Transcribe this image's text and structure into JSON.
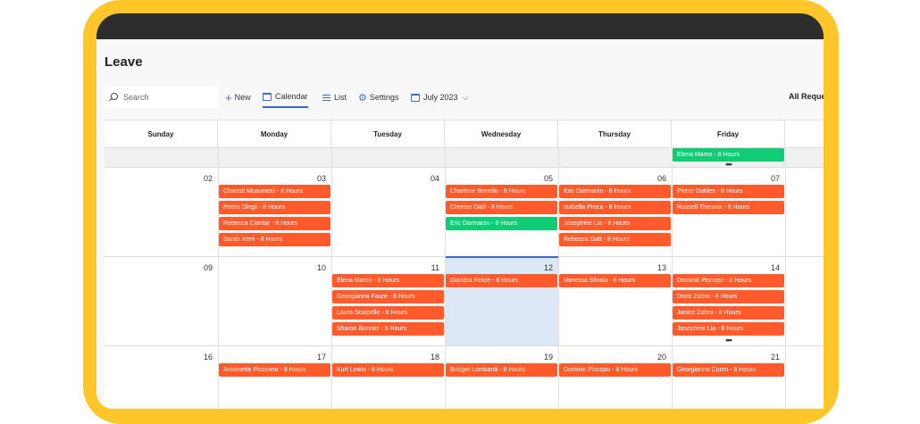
{
  "app": {
    "title": "Leave"
  },
  "toolbar": {
    "search_placeholder": "Search",
    "new_label": "New",
    "calendar_label": "Calendar",
    "list_label": "List",
    "settings_label": "Settings",
    "month_label": "July 2023",
    "filter_label": "All Reques"
  },
  "calendar": {
    "days": [
      "Sunday",
      "Monday",
      "Tuesday",
      "Wednesday",
      "Thursday",
      "Friday"
    ],
    "more_label": "•••",
    "prev_week": {
      "friday_events": [
        {
          "label": "Elena Mamo - 8 Hours",
          "color": "green"
        }
      ],
      "friday_more": true
    },
    "weeks": [
      {
        "dates": [
          "02",
          "03",
          "04",
          "05",
          "06",
          "07"
        ],
        "events": [
          [],
          [
            {
              "label": "Chantal Musumeci - 8 Hours",
              "color": "orange"
            },
            {
              "label": "Pedro Dingli - 8 Hours",
              "color": "orange"
            },
            {
              "label": "Rebecca Ciantar - 8 Hours",
              "color": "orange"
            },
            {
              "label": "Sarah Xerri - 8 Hours",
              "color": "orange"
            }
          ],
          [],
          [
            {
              "label": "Charlene Bonello - 8 Hours",
              "color": "orange"
            },
            {
              "label": "Cherise Dalli - 8 Hours",
              "color": "orange"
            },
            {
              "label": "Eric Darmanin - 8 Hours",
              "color": "green"
            }
          ],
          [
            {
              "label": "Eric Darmanin - 8 Hours",
              "color": "orange"
            },
            {
              "label": "Isabella Preca - 8 Hours",
              "color": "orange"
            },
            {
              "label": "Josephine Lia - 8 Hours",
              "color": "orange"
            },
            {
              "label": "Rebecca Gatt - 8 Hours",
              "color": "orange"
            }
          ],
          [
            {
              "label": "Pierre Galdes - 8 Hours",
              "color": "orange"
            },
            {
              "label": "Russell Theuma - 8 Hours",
              "color": "orange"
            }
          ]
        ]
      },
      {
        "dates": [
          "09",
          "10",
          "11",
          "12",
          "13",
          "14"
        ],
        "today_index": 3,
        "friday_more": true,
        "events": [
          [],
          [],
          [
            {
              "label": "Elena Mamo - 8 Hours",
              "color": "orange"
            },
            {
              "label": "Georgianna Faure - 8 Hours",
              "color": "orange"
            },
            {
              "label": "Laura Scalpello - 8 Hours",
              "color": "orange"
            },
            {
              "label": "Sharon Bonnici - 8 Hours",
              "color": "orange"
            }
          ],
          [
            {
              "label": "Diandra Felice - 8 Hours",
              "color": "orange"
            }
          ],
          [
            {
              "label": "Vanessa Silvala - 8 Hours",
              "color": "orange"
            }
          ],
          [
            {
              "label": "Dominic Piscopo - 8 Hours",
              "color": "orange"
            },
            {
              "label": "Doris Zahra - 8 Hours",
              "color": "orange"
            },
            {
              "label": "Janice Zahra - 8 Hours",
              "color": "orange"
            },
            {
              "label": "Josephine Lia - 8 Hours",
              "color": "orange"
            }
          ]
        ]
      },
      {
        "dates": [
          "16",
          "17",
          "18",
          "19",
          "20",
          "21"
        ],
        "events": [
          [],
          [
            {
              "label": "Antoinette Piccinino - 8 Hours",
              "color": "orange"
            }
          ],
          [
            {
              "label": "Kurt Lewis - 8 Hours",
              "color": "orange"
            }
          ],
          [
            {
              "label": "Bridget Lombardi - 8 Hours",
              "color": "orange"
            }
          ],
          [
            {
              "label": "Dominic Piscopo - 8 Hours",
              "color": "orange"
            }
          ],
          [
            {
              "label": "Georgianna Curmi - 8 Hours",
              "color": "orange"
            }
          ]
        ]
      }
    ]
  }
}
